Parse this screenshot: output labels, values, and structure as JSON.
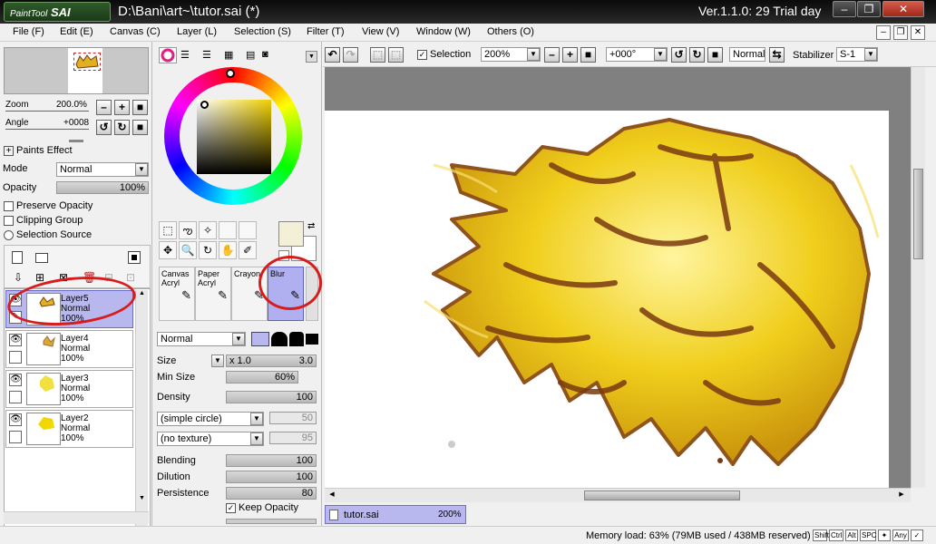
{
  "titlebar": {
    "logo_main": "PaintTool",
    "logo_sai": "SAI",
    "title": "D:\\Bani\\art~\\tutor.sai (*)",
    "version": "Ver.1.1.0: 29 Trial day"
  },
  "menu": [
    "File (F)",
    "Edit (E)",
    "Canvas (C)",
    "Layer (L)",
    "Selection (S)",
    "Filter (T)",
    "View (V)",
    "Window (W)",
    "Others (O)"
  ],
  "navigator": {
    "zoom_label": "Zoom",
    "zoom_value": "200.0%",
    "angle_label": "Angle",
    "angle_value": "+0008"
  },
  "layer_props": {
    "paints_effect": "Paints Effect",
    "mode_label": "Mode",
    "mode_value": "Normal",
    "opacity_label": "Opacity",
    "opacity_value": "100%",
    "preserve_opacity": "Preserve Opacity",
    "clipping_group": "Clipping Group",
    "selection_source": "Selection Source"
  },
  "layers": [
    {
      "name": "Layer5",
      "mode": "Normal",
      "opacity": "100%",
      "selected": true
    },
    {
      "name": "Layer4",
      "mode": "Normal",
      "opacity": "100%",
      "selected": false
    },
    {
      "name": "Layer3",
      "mode": "Normal",
      "opacity": "100%",
      "selected": false
    },
    {
      "name": "Layer2",
      "mode": "Normal",
      "opacity": "100%",
      "selected": false
    }
  ],
  "brushes": [
    {
      "line1": "Canvas",
      "line2": "Acryl"
    },
    {
      "line1": "Paper",
      "line2": "Acryl"
    },
    {
      "line1": "Crayon",
      "line2": ""
    },
    {
      "line1": "Blur",
      "line2": ""
    }
  ],
  "brush_settings": {
    "blend_mode": "Normal",
    "size_label": "Size",
    "size_mult": "x 1.0",
    "size_value": "3.0",
    "min_size_label": "Min Size",
    "min_size_value": "60%",
    "density_label": "Density",
    "density_value": "100",
    "shape": "(simple circle)",
    "shape_value": "50",
    "texture": "(no texture)",
    "texture_value": "95",
    "blending_label": "Blending",
    "blending_value": "100",
    "dilution_label": "Dilution",
    "dilution_value": "100",
    "persistence_label": "Persistence",
    "persistence_value": "80",
    "keep_opacity": "Keep Opacity"
  },
  "canvas_toolbar": {
    "selection_label": "Selection",
    "zoom_value": "200%",
    "angle_value": "+000°",
    "blend_value": "Normal",
    "stabilizer_label": "Stabilizer",
    "stabilizer_value": "S-1"
  },
  "document_tab": {
    "name": "tutor.sai",
    "zoom": "200%"
  },
  "status": {
    "memory": "Memory load: 63% (79MB used / 438MB reserved)",
    "keys": [
      "Shift",
      "Ctrl",
      "Alt",
      "SPC",
      "✦",
      "Any",
      "✓"
    ]
  },
  "colors": {
    "selection_purple": "#b8b8ee",
    "annotation_red": "#d81c1c",
    "hair_yellow": "#f0c800",
    "hair_brown": "#7a3a10"
  }
}
